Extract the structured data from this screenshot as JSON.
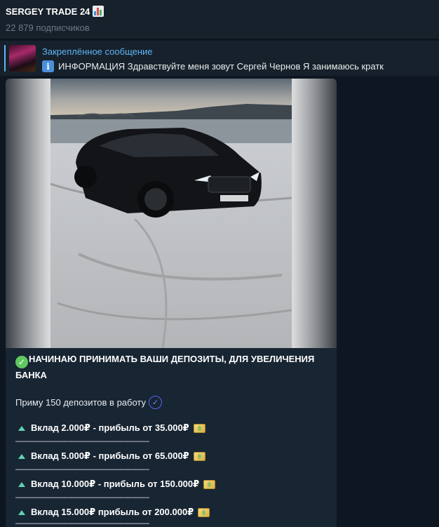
{
  "header": {
    "title": "SERGEY TRADE 24",
    "title_icon": "bar-chart-icon",
    "subscribers": "22 879 подписчиков"
  },
  "pinned": {
    "label": "Закреплённое сообщение",
    "icon": "info-icon",
    "text": "ИНФОРМАЦИЯ Здравствуйте меня зовут Сергей Чернов  Я занимаюсь кратк"
  },
  "post": {
    "photo": "black-sports-car-on-snow",
    "headline": "НАЧИНАЮ ПРИНИМАТЬ ВАШИ ДЕПОЗИТЫ, ДЛЯ УВЕЛИЧЕНИЯ БАНКА",
    "accept_line": "Приму 150 депозитов в работу",
    "tiers": [
      {
        "text": "Вклад 2.000₽ - прибыль от 35.000₽"
      },
      {
        "text": "Вклад 5.000₽ - прибыль от 65.000₽"
      },
      {
        "text": "Вклад 10.000₽ - прибыль от 150.000₽"
      },
      {
        "text": "Вклад 15.000₽ прибыль от 200.000₽"
      }
    ],
    "divider": "———————————————————"
  },
  "colors": {
    "background": "#0e1621",
    "panel": "#17212b",
    "bubble": "#182533",
    "accent": "#5eb5f7",
    "muted": "#6c7883"
  }
}
